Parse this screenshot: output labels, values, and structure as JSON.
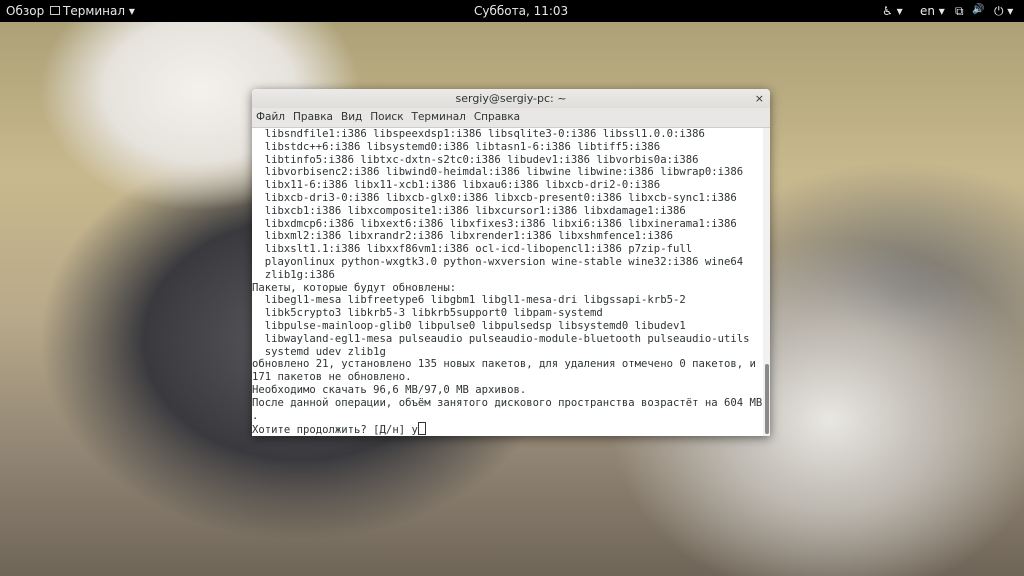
{
  "topbar": {
    "overview": "Обзор",
    "app_menu": "Терминал ▾",
    "clock": "Суббота, 11:03",
    "accessibility": "♿ ▾",
    "lang": "en ▾",
    "network": "⧉",
    "volume": "🔊",
    "power": "⏻ ▾"
  },
  "window": {
    "title": "sergiy@sergiy-pc: ~",
    "close": "×",
    "menu": [
      "Файл",
      "Правка",
      "Вид",
      "Поиск",
      "Терминал",
      "Справка"
    ],
    "lines": [
      "  libsndfile1:i386 libspeexdsp1:i386 libsqlite3-0:i386 libssl1.0.0:i386",
      "  libstdc++6:i386 libsystemd0:i386 libtasn1-6:i386 libtiff5:i386",
      "  libtinfo5:i386 libtxc-dxtn-s2tc0:i386 libudev1:i386 libvorbis0a:i386",
      "  libvorbisenc2:i386 libwind0-heimdal:i386 libwine libwine:i386 libwrap0:i386",
      "  libx11-6:i386 libx11-xcb1:i386 libxau6:i386 libxcb-dri2-0:i386",
      "  libxcb-dri3-0:i386 libxcb-glx0:i386 libxcb-present0:i386 libxcb-sync1:i386",
      "  libxcb1:i386 libxcomposite1:i386 libxcursor1:i386 libxdamage1:i386",
      "  libxdmcp6:i386 libxext6:i386 libxfixes3:i386 libxi6:i386 libxinerama1:i386",
      "  libxml2:i386 libxrandr2:i386 libxrender1:i386 libxshmfence1:i386",
      "  libxslt1.1:i386 libxxf86vm1:i386 ocl-icd-libopencl1:i386 p7zip-full",
      "  playonlinux python-wxgtk3.0 python-wxversion wine-stable wine32:i386 wine64",
      "  zlib1g:i386",
      "Пакеты, которые будут обновлены:",
      "  libegl1-mesa libfreetype6 libgbm1 libgl1-mesa-dri libgssapi-krb5-2",
      "  libk5crypto3 libkrb5-3 libkrb5support0 libpam-systemd",
      "  libpulse-mainloop-glib0 libpulse0 libpulsedsp libsystemd0 libudev1",
      "  libwayland-egl1-mesa pulseaudio pulseaudio-module-bluetooth pulseaudio-utils",
      "  systemd udev zlib1g",
      "обновлено 21, установлено 135 новых пакетов, для удаления отмечено 0 пакетов, и",
      "171 пакетов не обновлено.",
      "Необходимо скачать 96,6 MB/97,0 MB архивов.",
      "После данной операции, объём занятого дискового пространства возрастёт на 604 MB",
      "."
    ],
    "prompt": "Хотите продолжить? [Д/н] y"
  }
}
